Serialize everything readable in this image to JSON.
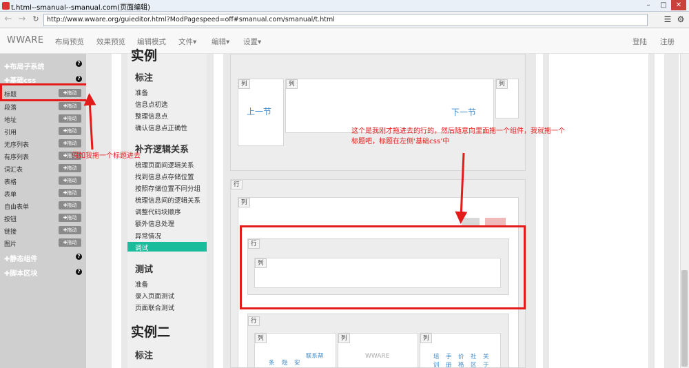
{
  "window": {
    "title": "t.html--smanual--smanual.com(页面编辑)"
  },
  "browser": {
    "url": "http://www.wware.org/guieditor.html?ModPagespeed=off#smanual.com/smanual/t.html"
  },
  "appnav": {
    "brand": "WWARE",
    "items": [
      "布局预览",
      "效果预览",
      "编辑模式",
      "文件▾",
      "编辑▾",
      "设置▾"
    ],
    "login": "登陆",
    "register": "注册"
  },
  "sidebar": {
    "groups": {
      "layout": "✚布局子系统",
      "basic": "✚基础css",
      "static": "✚静态组件",
      "script": "✚脚本区块"
    },
    "drag_label": "✚拖动",
    "items": [
      "标题",
      "段落",
      "地址",
      "引用",
      "无序列表",
      "有序列表",
      "词汇表",
      "表格",
      "表单",
      "自由表单",
      "按钮",
      "链接",
      "图片"
    ]
  },
  "navcol": {
    "example1": "实例",
    "sec_label": "标注",
    "sec_label_items": [
      "准备",
      "信息点初选",
      "整理信息点",
      "确认信息点正确性"
    ],
    "sec_logic": "补齐逻辑关系",
    "sec_logic_items": [
      "梳理页面间逻辑关系",
      "找到信息点存储位置",
      "按照存储位置不同分组",
      "梳理信息间的逻辑关系",
      "调整代码块顺序",
      "额外信息处理",
      "异常情况",
      "调试"
    ],
    "sec_test": "测试",
    "sec_test_items": [
      "准备",
      "录入页面测试",
      "页面联合测试"
    ],
    "example2": "实例二",
    "sec_label2": "标注"
  },
  "content": {
    "col_tag": "列",
    "row_tag": "行",
    "prev": "上一节",
    "next": "下一节",
    "watermark": "WWARE",
    "bottom_col2_chars": [
      "条",
      "隐",
      "安",
      "联系帮"
    ],
    "bottom_col3_chars": [
      "培训",
      "手册",
      "价格",
      "社区",
      "关于"
    ]
  },
  "annotations": {
    "left": "假如我拖一个标题进去",
    "right_line1": "这个是我刚才拖进去的行的，然后随意向里面拖一个组件，我就拖一个",
    "right_line2": "标题吧，标题在左侧‘基础css’中"
  },
  "colors": {
    "accent": "#1abc9c",
    "annotation": "#e41b1b",
    "link": "#428bca"
  }
}
